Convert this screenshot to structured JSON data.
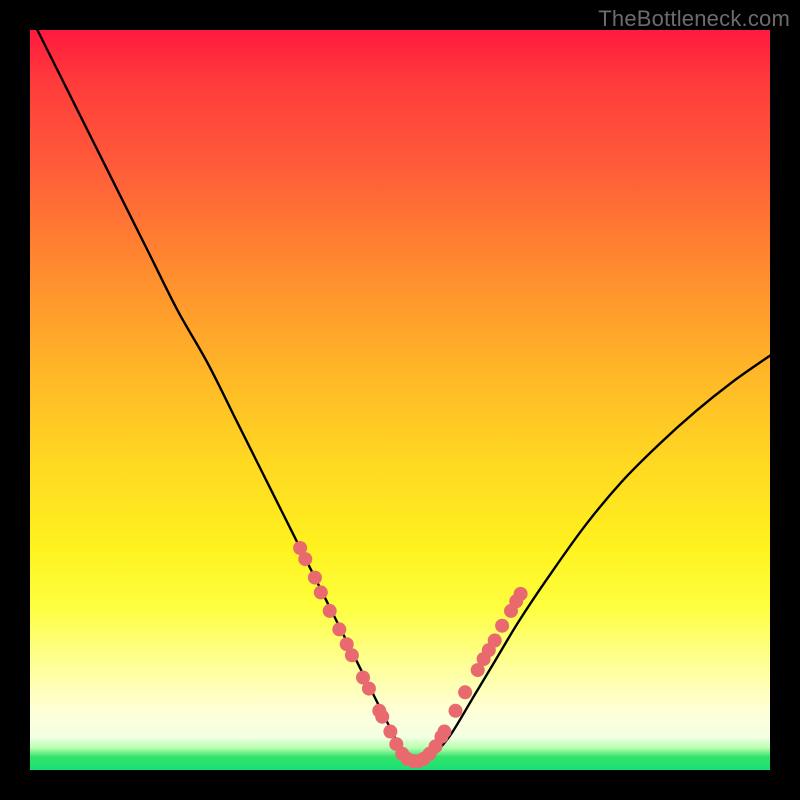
{
  "watermark": "TheBottleneck.com",
  "chart_data": {
    "type": "line",
    "title": "",
    "xlabel": "",
    "ylabel": "",
    "xlim": [
      0,
      100
    ],
    "ylim": [
      0,
      100
    ],
    "series": [
      {
        "name": "bottleneck-curve",
        "x": [
          1,
          4,
          8,
          12,
          16,
          20,
          24,
          28,
          31,
          34,
          37,
          39,
          41,
          43,
          45,
          46.5,
          48,
          49,
          50,
          51,
          52,
          53.5,
          55,
          57,
          60,
          63,
          66,
          70,
          75,
          80,
          85,
          90,
          95,
          100
        ],
        "values": [
          100,
          94,
          86,
          78,
          70,
          62,
          55,
          47,
          41,
          35,
          29,
          25,
          21,
          17,
          13,
          10,
          7,
          5,
          3,
          1.5,
          1,
          1.2,
          2.5,
          5,
          10,
          15,
          20,
          26,
          33,
          39,
          44,
          48.5,
          52.5,
          56
        ]
      }
    ],
    "markers": {
      "name": "highlight-points",
      "color": "#e96a6e",
      "points": [
        {
          "x": 36.5,
          "y": 30
        },
        {
          "x": 37.2,
          "y": 28.5
        },
        {
          "x": 38.5,
          "y": 26
        },
        {
          "x": 39.3,
          "y": 24
        },
        {
          "x": 40.5,
          "y": 21.5
        },
        {
          "x": 41.8,
          "y": 19
        },
        {
          "x": 42.8,
          "y": 17
        },
        {
          "x": 43.5,
          "y": 15.5
        },
        {
          "x": 45.0,
          "y": 12.5
        },
        {
          "x": 45.8,
          "y": 11
        },
        {
          "x": 47.2,
          "y": 8
        },
        {
          "x": 47.6,
          "y": 7.2
        },
        {
          "x": 48.7,
          "y": 5.2
        },
        {
          "x": 49.5,
          "y": 3.5
        },
        {
          "x": 50.3,
          "y": 2.2
        },
        {
          "x": 51.0,
          "y": 1.5
        },
        {
          "x": 51.8,
          "y": 1.2
        },
        {
          "x": 52.5,
          "y": 1.2
        },
        {
          "x": 53.2,
          "y": 1.5
        },
        {
          "x": 54.0,
          "y": 2.2
        },
        {
          "x": 54.8,
          "y": 3.2
        },
        {
          "x": 55.6,
          "y": 4.5
        },
        {
          "x": 56.0,
          "y": 5.2
        },
        {
          "x": 57.5,
          "y": 8
        },
        {
          "x": 58.8,
          "y": 10.5
        },
        {
          "x": 60.5,
          "y": 13.5
        },
        {
          "x": 61.3,
          "y": 15
        },
        {
          "x": 62.0,
          "y": 16.2
        },
        {
          "x": 62.8,
          "y": 17.5
        },
        {
          "x": 63.8,
          "y": 19.5
        },
        {
          "x": 65.0,
          "y": 21.5
        },
        {
          "x": 65.7,
          "y": 22.8
        },
        {
          "x": 66.3,
          "y": 23.8
        }
      ]
    }
  }
}
